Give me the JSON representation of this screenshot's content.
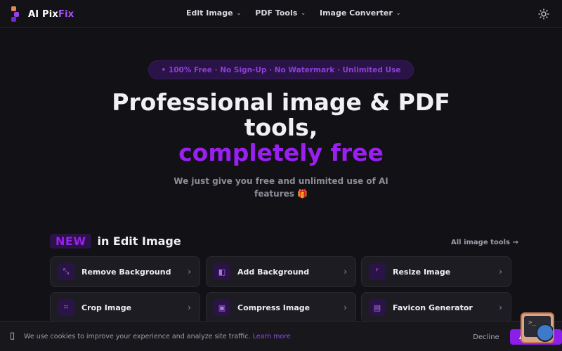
{
  "navbar": {
    "logo_text_main": "AI Pix",
    "logo_text_accent": "Fix",
    "menu": [
      {
        "label": "Edit Image"
      },
      {
        "label": "PDF Tools"
      },
      {
        "label": "Image Converter"
      }
    ],
    "theme_icon": "sun-icon"
  },
  "hero": {
    "badge": "• 100% Free · No Sign-Up · No Watermark · Unlimited Use",
    "title_line1": "Professional image & PDF tools,",
    "title_line2": "completely free",
    "subtitle": "We just give you free and unlimited use of AI features 🎁"
  },
  "section": {
    "new_tag": "NEW",
    "title": "in Edit Image",
    "all_link": "All image tools →"
  },
  "tools": [
    {
      "label": "Remove Background",
      "icon": "magic-wand-icon"
    },
    {
      "label": "Add Background",
      "icon": "layers-icon"
    },
    {
      "label": "Resize Image",
      "icon": "resize-icon"
    },
    {
      "label": "Crop Image",
      "icon": "crop-icon"
    },
    {
      "label": "Compress Image",
      "icon": "compress-icon"
    },
    {
      "label": "Favicon Generator",
      "icon": "favicon-icon"
    }
  ],
  "cookie": {
    "text": "We use cookies to improve your experience and analyze site traffic.",
    "learn_more": "Learn more",
    "decline": "Decline",
    "accept": "Accept"
  },
  "colors": {
    "accent": "#9a1ff0",
    "background": "#121116",
    "card": "#1d1c22"
  }
}
